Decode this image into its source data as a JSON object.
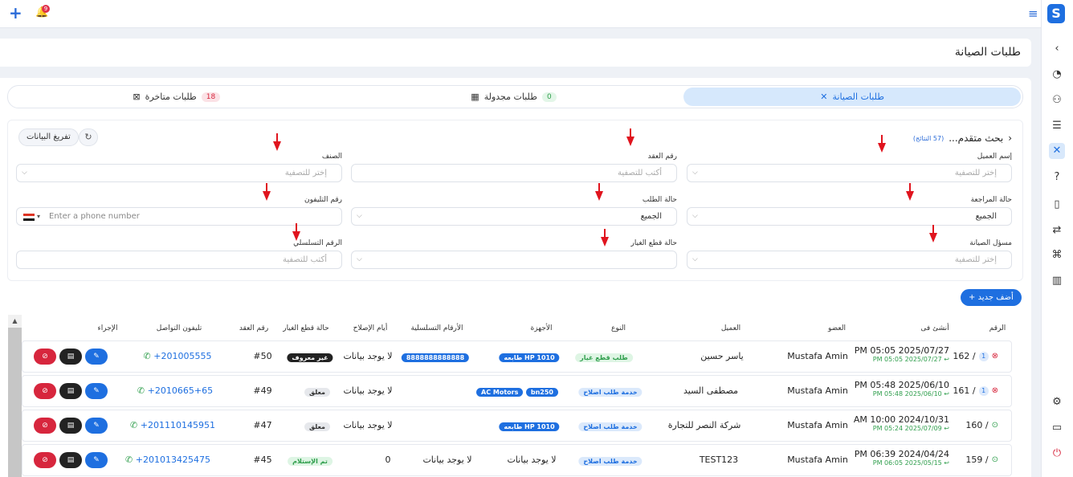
{
  "header": {
    "add_icon": "plus-icon",
    "notification_count": "9",
    "menu_icon": "hamburger-icon"
  },
  "sidebar": {
    "items": [
      "dashboard-icon",
      "users-icon",
      "list-icon",
      "tools-icon",
      "help-icon",
      "document-icon",
      "route-icon",
      "hierarchy-icon",
      "chart-icon",
      "settings-icon",
      "window-icon",
      "power-icon"
    ]
  },
  "page": {
    "title": "طلبات الصيانة"
  },
  "tabs": [
    {
      "label": "طلبات الصيانة",
      "count": ""
    },
    {
      "label": "طلبات مجدولة",
      "count": "0"
    },
    {
      "label": "طلبات متاخرة",
      "count": "18"
    }
  ],
  "filters": {
    "advanced_label": "بحث متقدم...",
    "results": "(57 النتائج)",
    "export_label": "تفريغ البيانات",
    "customer_label": "إسم العميل",
    "customer_ph": "إختر للتصفية",
    "contract_label": "رقم العقد",
    "contract_ph": "أكتب للتصفية",
    "category_label": "الصنف",
    "category_ph": "إختر للتصفية",
    "review_label": "حالة المراجعة",
    "review_val": "الجميع",
    "order_label": "حالة الطلب",
    "order_val": "الجميع",
    "phone_label": "رقم التليفون",
    "phone_ph": "Enter a phone number",
    "tech_label": "مسؤل الصيانة",
    "tech_ph": "إختر للتصفية",
    "parts_label": "حالة قطع الغيار",
    "serial_label": "الرقم التسلسلي",
    "serial_ph": "أكتب للتصفية"
  },
  "add_new": "+ أضف جديد",
  "table": {
    "headers": {
      "num": "الرقم",
      "created": "أنشئ فى",
      "member": "العضو",
      "customer": "العميل",
      "type": "النوع",
      "devices": "الأجهزة",
      "serials": "الأرقام التسلسلية",
      "repair_days": "أيام الإصلاح",
      "parts": "حالة قطع الغيار",
      "contract": "رقم العقد",
      "phone": "تليفون التواصل",
      "action": "الإجراء"
    },
    "rows": [
      {
        "num": "162 /",
        "badge": "1",
        "date": "PM 05:05 2025/07/27",
        "updated": "PM 05:05 2025/07/27 ↩",
        "member": "Mustafa Amin",
        "customer": "ياسر حسين",
        "type": "طلب قطع غيار",
        "devices": [
          "طابعه HP 1010"
        ],
        "serials": "8888888888888",
        "repair_days": "لا يوجد بيانات",
        "parts": "غير معروف",
        "contract": "#50",
        "phone": "+201005555"
      },
      {
        "num": "161 /",
        "badge": "1",
        "date": "PM 05:48 2025/06/10",
        "updated": "PM 05:48 2025/06/10 ↩",
        "member": "Mustafa Amin",
        "customer": "مصطفى السيد",
        "type": "خدمة طلب اصلاح",
        "devices": [
          "bn250",
          "AC Motors"
        ],
        "serials": "",
        "repair_days": "لا يوجد بيانات",
        "parts": "معلق",
        "contract": "#49",
        "phone": "+2010665+65"
      },
      {
        "num": "160 /",
        "badge": "",
        "date": "AM 10:00 2024/10/31",
        "updated": "PM 05:24 2025/07/09 ↩",
        "member": "Mustafa Amin",
        "customer": "شركة النصر للتجارة",
        "type": "خدمة طلب اصلاح",
        "devices": [
          "طابعه HP 1010"
        ],
        "serials": "",
        "repair_days": "لا يوجد بيانات",
        "parts": "معلق",
        "contract": "#47",
        "phone": "+201110145951"
      },
      {
        "num": "159 /",
        "badge": "",
        "date": "PM 06:39 2024/04/24",
        "updated": "PM 06:05 2025/05/15 ↩",
        "member": "Mustafa Amin",
        "customer": "TEST123",
        "type": "خدمة طلب اصلاح",
        "devices_text": "لا يوجد بيانات",
        "serials": "لا يوجد بيانات",
        "repair_days": "0",
        "parts": "تم الإستلام",
        "contract": "#45",
        "phone": "+201013425475"
      }
    ]
  }
}
